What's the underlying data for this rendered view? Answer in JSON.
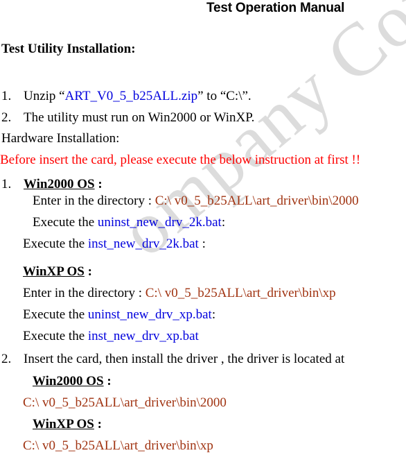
{
  "document": {
    "title": "Test Operation Manual",
    "title_color": "#ff0000",
    "section_heading": "Test Utility Installation:",
    "watermark": "ompany Con"
  },
  "colors": {
    "warning": "#ff0000",
    "file": "#0000dd",
    "path": "#a03311",
    "text": "#000000",
    "watermark": "#dcdcdc"
  },
  "install_steps": {
    "item1": {
      "number": "1.",
      "before": "Unzip “",
      "file": "ART_V0_5_b25ALL.zip",
      "after": "” to “C:\\”."
    },
    "item2": {
      "number": "2.",
      "text": "The utility must run on Win2000 or WinXP."
    }
  },
  "hardware": {
    "heading": "Hardware Installation:",
    "warning": "Before insert the card, please execute the below instruction at first !!",
    "step1": {
      "number": "1.",
      "os_label": "Win2000 OS",
      "colon": " :",
      "dir_prefix": "Enter in the directory : ",
      "dir_path": "C:\\ v0_5_b25ALL\\art_driver\\bin\\2000",
      "exec_uninstall_prefix": "Execute the ",
      "exec_uninstall_file": "uninst_new_drv_2k.bat",
      "exec_uninstall_suffix": ":",
      "exec_install_prefix": "Execute the ",
      "exec_install_file": "inst_new_drv_2k.bat",
      "exec_install_suffix": " :"
    },
    "stepxp": {
      "os_label": "WinXP OS",
      "colon": " :",
      "dir_prefix": "Enter in the directory : ",
      "dir_path": "C:\\ v0_5_b25ALL\\art_driver\\bin\\xp",
      "exec_uninstall_prefix": "Execute the ",
      "exec_uninstall_file": "uninst_new_drv_xp.bat",
      "exec_uninstall_suffix": ":",
      "exec_install_prefix": "Execute the ",
      "exec_install_file": "inst_new_drv_xp.bat"
    },
    "step2": {
      "number": "2.",
      "text": "Insert the card, then install the driver , the driver is located at",
      "win2000_label": "Win2000 OS",
      "win2000_colon": " :",
      "win2000_path": "C:\\ v0_5_b25ALL\\art_driver\\bin\\2000",
      "winxp_label": "WinXP OS",
      "winxp_colon": " :",
      "winxp_path": "C:\\ v0_5_b25ALL\\art_driver\\bin\\xp"
    }
  }
}
